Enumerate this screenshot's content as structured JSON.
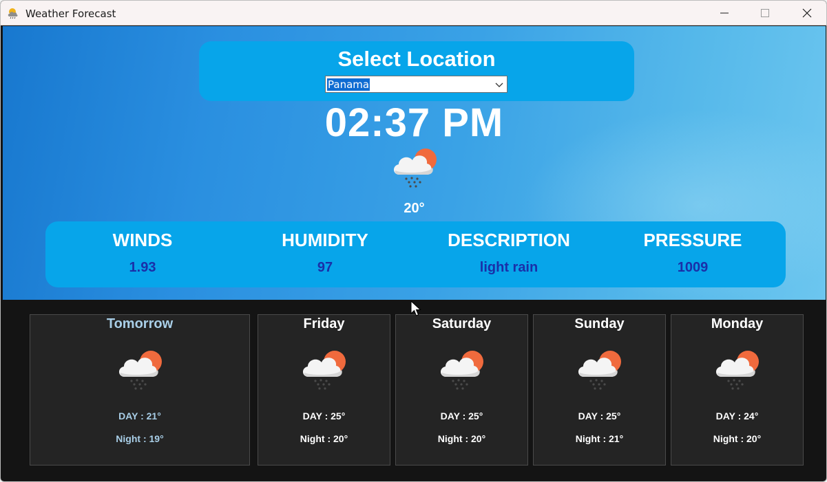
{
  "window": {
    "title": "Weather Forecast",
    "app_icon": "weather-cloud-sun-icon",
    "controls": [
      "minimize-icon",
      "maximize-icon",
      "close-icon"
    ]
  },
  "location": {
    "title": "Select Location",
    "selected": "Panama"
  },
  "current": {
    "time": "02:37 PM",
    "icon": "cloud-sun-rain-icon",
    "temperature": "20°"
  },
  "stats": [
    {
      "label": "WINDS",
      "value": "1.93"
    },
    {
      "label": "HUMIDITY",
      "value": "97"
    },
    {
      "label": "DESCRIPTION",
      "value": "light rain"
    },
    {
      "label": "PRESSURE",
      "value": "1009"
    }
  ],
  "forecast": [
    {
      "day": "Tomorrow",
      "day_temp": "DAY : 21°",
      "night_temp": "Night : 19°",
      "icon": "cloud-sun-rain-icon"
    },
    {
      "day": "Friday",
      "day_temp": "DAY : 25°",
      "night_temp": "Night : 20°",
      "icon": "cloud-sun-rain-icon"
    },
    {
      "day": "Saturday",
      "day_temp": "DAY : 25°",
      "night_temp": "Night : 20°",
      "icon": "cloud-sun-rain-icon"
    },
    {
      "day": "Sunday",
      "day_temp": "DAY : 25°",
      "night_temp": "Night : 21°",
      "icon": "cloud-sun-rain-icon"
    },
    {
      "day": "Monday",
      "day_temp": "DAY : 24°",
      "night_temp": "Night : 20°",
      "icon": "cloud-sun-rain-icon"
    }
  ],
  "colors": {
    "panel": "#07a5ea",
    "stat_value": "#1a2fa8",
    "card_background": "#242424",
    "highlight_day": "#a9cfe8"
  }
}
